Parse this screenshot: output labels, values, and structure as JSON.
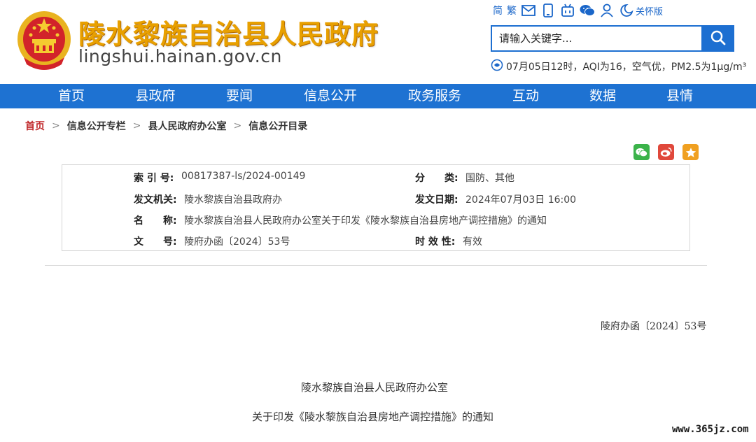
{
  "header": {
    "site_title": "陵水黎族自治县人民政府",
    "site_domain": "lingshui.hainan.gov.cn",
    "emblem_icon": "national-emblem-icon"
  },
  "toolbar": {
    "simplified": "简",
    "traditional": "繁",
    "care_mode": "关怀版",
    "icons": [
      "mail-icon",
      "mobile-icon",
      "mini-program-icon",
      "wechat-icon",
      "user-icon",
      "care-mode-icon"
    ]
  },
  "search": {
    "placeholder": "请输入关键字..."
  },
  "weather": {
    "text": "07月05日12时，AQI为16，空气优，PM2.5为1μg/m³"
  },
  "nav": {
    "items": [
      "首页",
      "县政府",
      "要闻",
      "信息公开",
      "政务服务",
      "互动",
      "数据",
      "县情"
    ]
  },
  "breadcrumb": {
    "items": [
      "首页",
      "信息公开专栏",
      "县人民政府办公室",
      "信息公开目录"
    ],
    "separator": ">"
  },
  "share": {
    "icons": [
      "wechat-share-icon",
      "weibo-share-icon",
      "favorite-star-icon"
    ]
  },
  "meta": {
    "index_label": "索 引 号:",
    "index_value": "00817387-ls/2024-00149",
    "category_label": "分　　类:",
    "category_value": "国防、其他",
    "issuer_label": "发文机关:",
    "issuer_value": "陵水黎族自治县政府办",
    "date_label": "发文日期:",
    "date_value": "2024年07月03日 16:00",
    "title_label": "名　　称:",
    "title_value": "陵水黎族自治县人民政府办公室关于印发《陵水黎族自治县房地产调控措施》的通知",
    "number_label": "文　　号:",
    "number_value": "陵府办函〔2024〕53号",
    "validity_label": "时 效 性:",
    "validity_value": "有效"
  },
  "document": {
    "number": "陵府办函〔2024〕53号",
    "org": "陵水黎族自治县人民政府办公室",
    "subject": "关于印发《陵水黎族自治县房地产调控措施》的通知"
  },
  "watermark": "www.365jz.com",
  "colors": {
    "nav_blue": "#1e72d2",
    "title_gold": "#e8a000",
    "home_red": "#c0282a",
    "wechat_green": "#3bb34a",
    "weibo_red": "#e0483b",
    "favorite_orange": "#f0a020"
  }
}
